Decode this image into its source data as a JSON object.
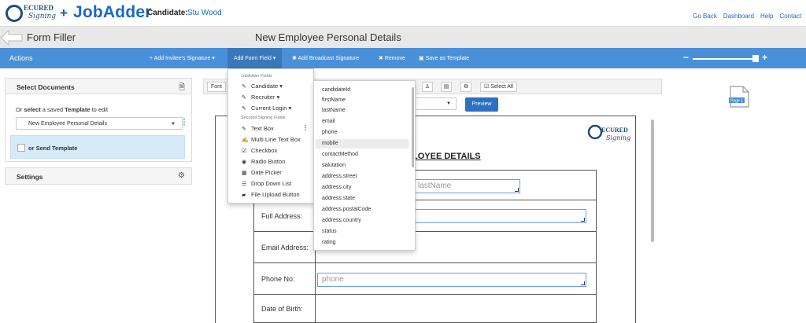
{
  "brand": {
    "logo_top": "ECURED",
    "logo_bottom": "Signing",
    "plus": "+",
    "jobadder": "JobAdder"
  },
  "candidate": {
    "label": "Candidate:",
    "name": "Stu Wood"
  },
  "top_links": [
    "Go Back",
    "Dashboard",
    "Help",
    "Contact"
  ],
  "header": {
    "left_title": "Form Filler",
    "page_title": "New Employee Personal Details"
  },
  "actionbar": {
    "label": "Actions",
    "add_invitee": "+ Add Invitee's Signature ▾",
    "add_form_field": "Add Form Field ▾",
    "add_broadcast": "Add Broadcast Signature",
    "remove": "✖ Remove",
    "save_template": "Save as Template",
    "zoom_minus": "−",
    "zoom_plus": "+",
    "zoom_level": 0.9
  },
  "left_panel": {
    "select_documents": "Select Documents",
    "or_select_prefix": "Or ",
    "or_select_bold": "select",
    "or_select_mid": " a saved ",
    "or_select_bold2": "Template",
    "or_select_suffix": " to edit",
    "template_value": "New Employee Personal Details",
    "send_template": "or Send Template",
    "settings": "Settings"
  },
  "toolbar": {
    "font_label": "Font",
    "select_all": "Select All",
    "preview": "Preview"
  },
  "document": {
    "heading": "LOYEE DETAILS",
    "seal_text": "ECURED",
    "seal_sub": "Signing",
    "rows": [
      {
        "label": "",
        "placeholder": "lastName"
      },
      {
        "label": "Full Address:",
        "placeholder": ""
      },
      {
        "label": "Email Address:",
        "placeholder": ""
      },
      {
        "label": "Phone No:",
        "placeholder": "phone"
      },
      {
        "label": "Date of Birth:",
        "placeholder": ""
      }
    ]
  },
  "page_thumb_label": "Page 1",
  "form_field_menu": {
    "jobadder_header": "JobAdder Fields",
    "candidate": "Candidate ▾",
    "recruiter": "Recruiter ▾",
    "current_login": "Current Login ▾",
    "secured_header": "Secured Signing Fields",
    "text_box": "Text Box",
    "multi_line": "Multi Line Text Box",
    "checkbox": "Checkbox",
    "radio": "Radio Button",
    "date_picker": "Date Picker",
    "drop_down": "Drop Down List",
    "file_upload": "File Upload Button"
  },
  "candidate_fields": [
    "candidateId",
    "firstName",
    "lastName",
    "email",
    "phone",
    "mobile",
    "contactMethod",
    "salutation",
    "address.street",
    "address.city",
    "address.state",
    "address.postalCode",
    "address.country",
    "status",
    "rating"
  ],
  "colors": {
    "action_bar": "#4a90d9",
    "brand_blue": "#1a69c4",
    "send_box": "#d6ebf7"
  }
}
